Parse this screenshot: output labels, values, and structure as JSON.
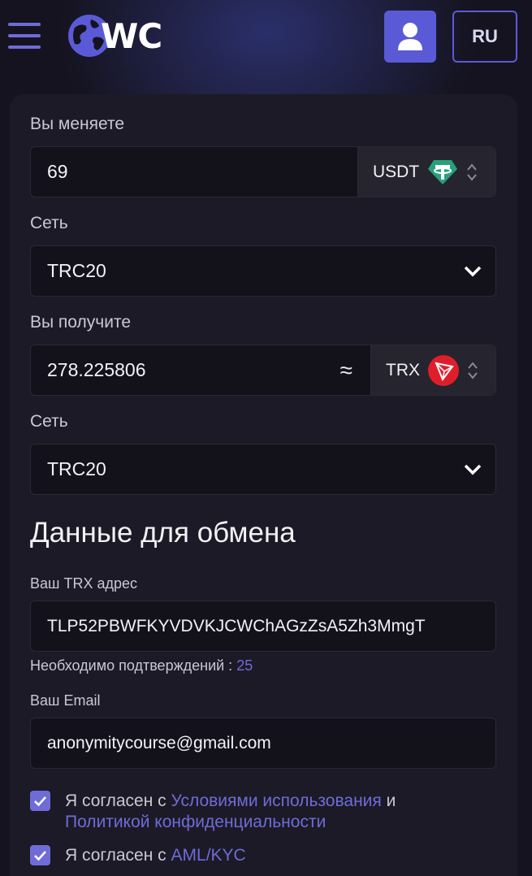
{
  "header": {
    "logo_text": "WC",
    "lang_label": "RU",
    "colors": {
      "accent": "#5b5ad6",
      "background": "#15131f"
    }
  },
  "exchange": {
    "give_label": "Вы меняете",
    "give_amount": "69",
    "give_currency": "USDT",
    "give_currency_icon": "tether-icon",
    "give_network_label": "Сеть",
    "give_network": "TRC20",
    "receive_label": "Вы получите",
    "receive_amount": "278.225806",
    "approx_sign": "≈",
    "receive_currency": "TRX",
    "receive_currency_icon": "tron-icon",
    "receive_network_label": "Сеть",
    "receive_network": "TRC20"
  },
  "details": {
    "title": "Данные для обмена",
    "address_label": "Ваш TRX адрес",
    "address_value": "TLP52PBWFKYVDVKJCWChAGzZsA5Zh3MmgT",
    "confirmations_label": "Необходимо подтверждений :",
    "confirmations_count": "25",
    "email_label": "Ваш Email",
    "email_value": "anonymitycourse@gmail.com"
  },
  "agreements": {
    "terms_prefix": "Я согласен с",
    "terms_link": "Условиями использования",
    "terms_and": "и",
    "privacy_link": "Политикой конфиденциальности",
    "aml_prefix": "Я согласен с",
    "aml_link": "AML/KYC"
  }
}
